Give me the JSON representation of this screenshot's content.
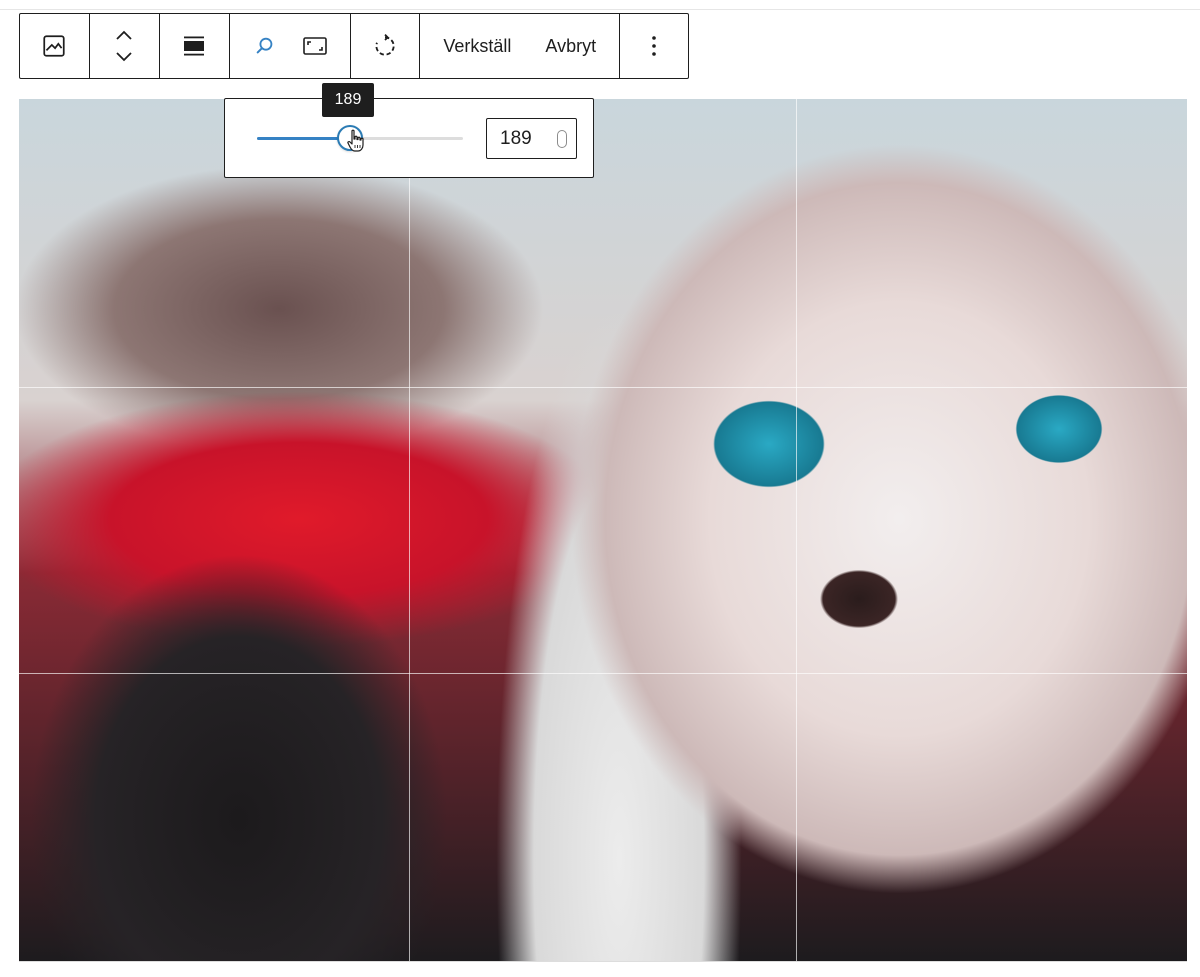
{
  "toolbar": {
    "groups": [
      {
        "items": [
          {
            "icon": "image-icon"
          }
        ]
      },
      {
        "items": [
          {
            "icon": "chevron-up-down-icon"
          }
        ]
      },
      {
        "items": [
          {
            "icon": "align-full-width-icon"
          }
        ]
      },
      {
        "items": [
          {
            "icon": "zoom-search-icon",
            "active": true
          },
          {
            "icon": "aspect-ratio-icon"
          }
        ]
      },
      {
        "items": [
          {
            "icon": "rotate-icon"
          }
        ]
      },
      {
        "items": [
          {
            "label": "Verkställ"
          },
          {
            "label": "Avbryt"
          }
        ]
      },
      {
        "items": [
          {
            "icon": "more-vertical-icon"
          }
        ]
      }
    ],
    "apply_label": "Verkställ",
    "cancel_label": "Avbryt"
  },
  "zoom": {
    "value": "189",
    "tooltip": "189",
    "slider_fraction": 0.45
  },
  "colors": {
    "accent": "#3582c4",
    "border": "#1e1e1e",
    "tooltip_bg": "#1e1e1e"
  }
}
